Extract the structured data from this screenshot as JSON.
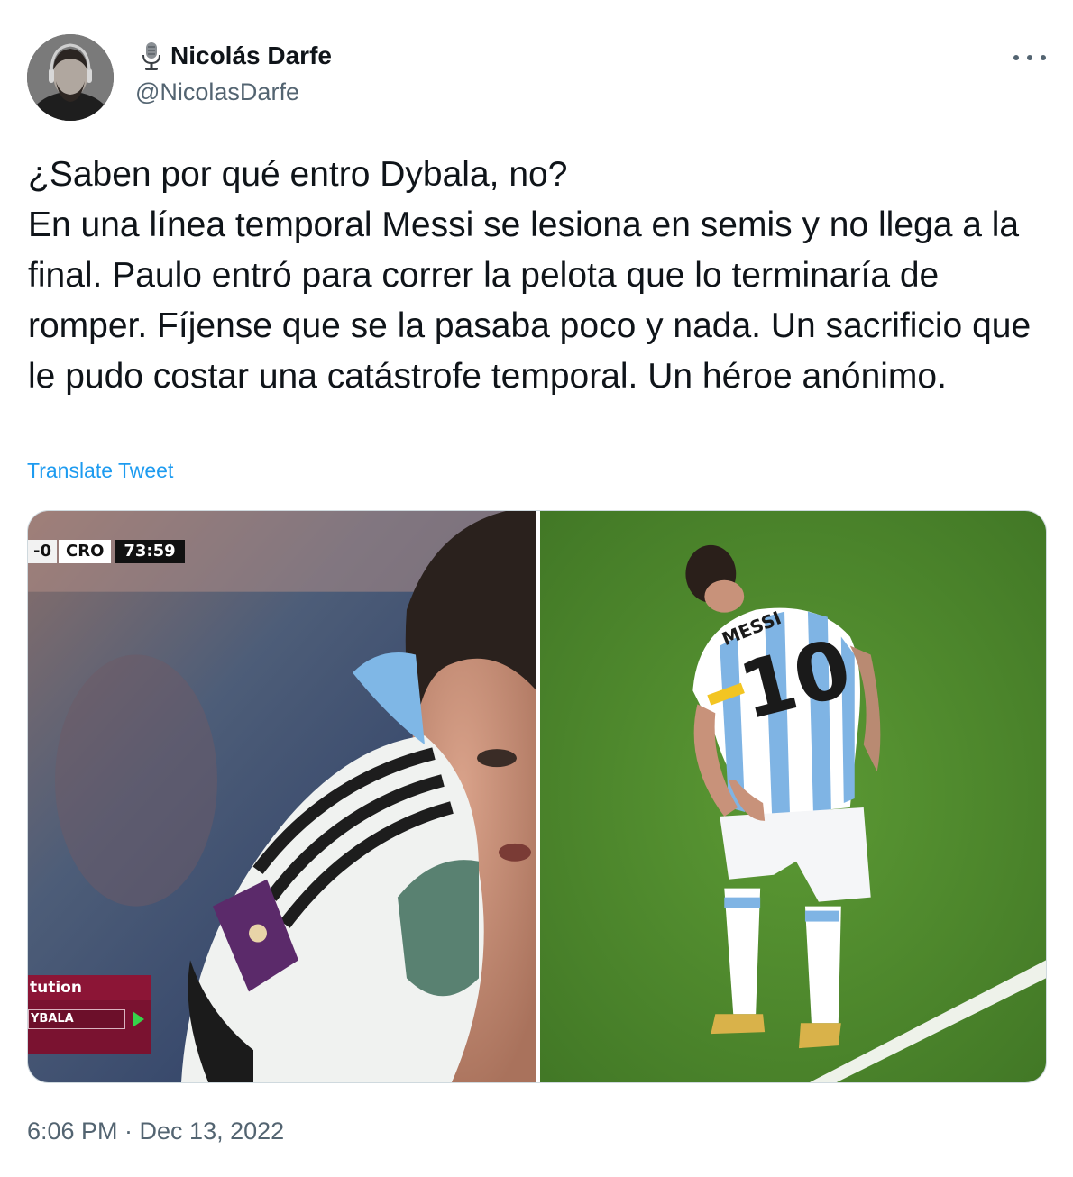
{
  "author": {
    "name": "Nicolás Darfe",
    "handle": "@NicolasDarfe",
    "name_icon": "microphone-icon"
  },
  "menu": {
    "more_icon": "more-horizontal-icon"
  },
  "tweet": {
    "text": "¿Saben por qué entro Dybala, no?\nEn una línea temporal Messi se lesiona en semis y no llega a la final. Paulo entró para correr la pelota que lo terminaría de romper. Fíjense que se la pasaba poco y nada. Un sacrificio que le pudo costar una catástrofe temporal. Un héroe anónimo.",
    "translate_label": "Translate Tweet",
    "timestamp": "6:06 PM · Dec 13, 2022"
  },
  "media": {
    "left": {
      "scorebug": {
        "score": "-0",
        "team": "CRO",
        "clock": "73:59"
      },
      "substitution": {
        "title": "tution",
        "player": "YBALA"
      }
    },
    "right": {
      "jersey_name": "MESSI",
      "jersey_number": "10"
    }
  },
  "colors": {
    "link": "#1d9bf0",
    "secondary_text": "#536471",
    "primary_text": "#0f1419",
    "pitch_green": "#4e8a2c"
  }
}
